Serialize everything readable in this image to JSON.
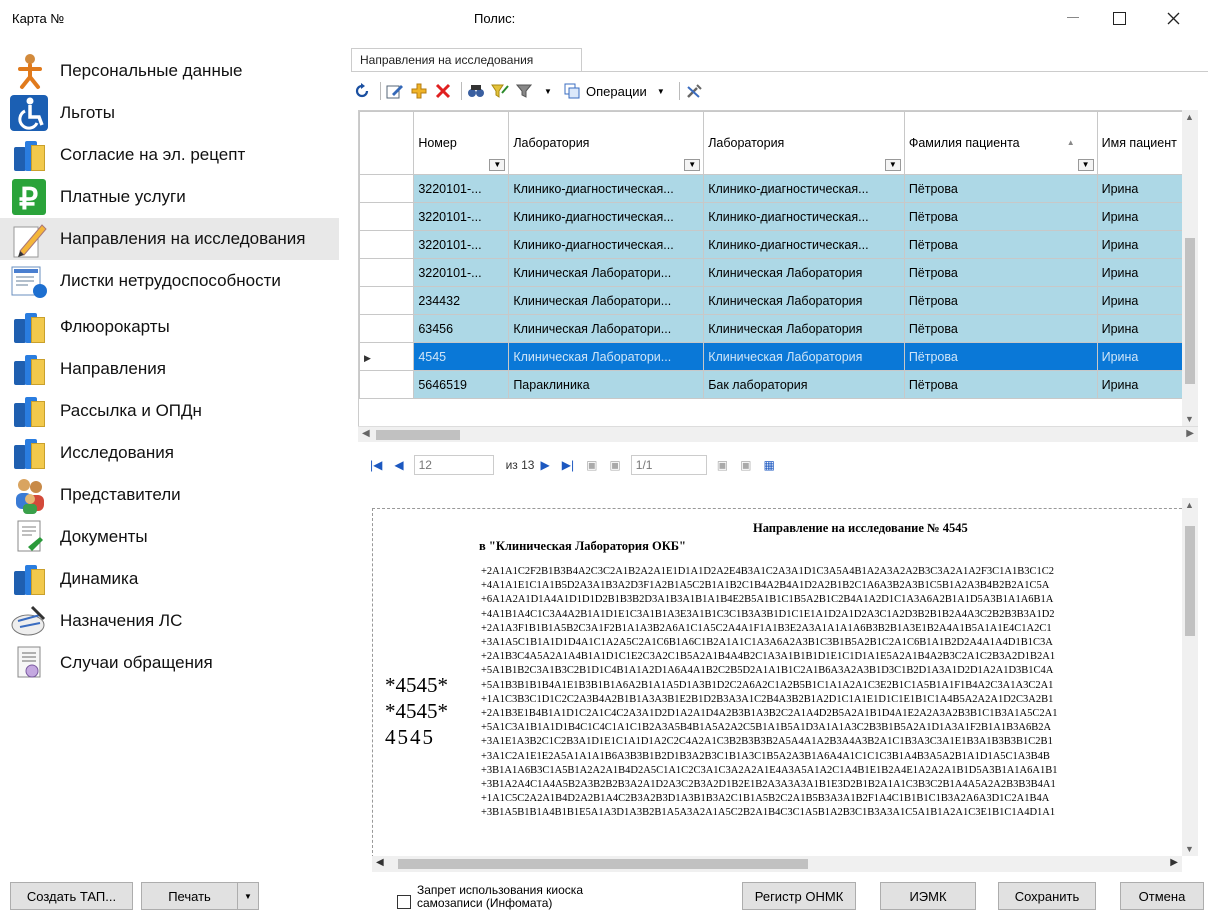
{
  "window": {
    "card_label": "Карта №",
    "policy_label": "Полис:",
    "minimize_icon": "minimize-icon",
    "maximize_icon": "maximize-icon",
    "close_icon": "close-icon"
  },
  "sidebar": {
    "items": [
      {
        "label": "Персональные данные",
        "icon": "person-icon"
      },
      {
        "label": "Льготы",
        "icon": "wheelchair-icon"
      },
      {
        "label": "Согласие на эл. рецепт",
        "icon": "books-icon"
      },
      {
        "label": "Платные услуги",
        "icon": "ruble-icon"
      },
      {
        "label": "Направления на исследования",
        "icon": "pencil-icon"
      },
      {
        "label": "Листки нетрудоспособности",
        "icon": "sick-leave-icon"
      },
      {
        "label": "Флюорокарты",
        "icon": "books-icon"
      },
      {
        "label": "Направления",
        "icon": "books-icon"
      },
      {
        "label": "Рассылка и ОПДн",
        "icon": "books-icon"
      },
      {
        "label": "Исследования",
        "icon": "books-icon"
      },
      {
        "label": "Представители",
        "icon": "people-icon"
      },
      {
        "label": "Документы",
        "icon": "document-icon"
      },
      {
        "label": "Динамика",
        "icon": "books-icon"
      },
      {
        "label": "Назначения ЛС",
        "icon": "prescription-icon"
      },
      {
        "label": "Случаи обращения",
        "icon": "case-icon"
      }
    ]
  },
  "tab": {
    "label": "Направления на исследования"
  },
  "toolbar": {
    "operations_label": "Операции"
  },
  "grid": {
    "columns": [
      "Номер",
      "Лаборатория",
      "Лаборатория",
      "Фамилия пациента",
      "Имя пациент"
    ],
    "rows": [
      [
        "3220101-...",
        "Клинико-диагностическая...",
        "Клинико-диагностическая...",
        "Пётрова",
        "Ирина"
      ],
      [
        "3220101-...",
        "Клинико-диагностическая...",
        "Клинико-диагностическая...",
        "Пётрова",
        "Ирина"
      ],
      [
        "3220101-...",
        "Клинико-диагностическая...",
        "Клинико-диагностическая...",
        "Пётрова",
        "Ирина"
      ],
      [
        "3220101-...",
        "Клиническая Лаборатори...",
        "Клиническая Лаборатория",
        "Пётрова",
        "Ирина"
      ],
      [
        "234432",
        "Клиническая Лаборатори...",
        "Клиническая Лаборатория",
        "Пётрова",
        "Ирина"
      ],
      [
        "63456",
        "Клиническая Лаборатори...",
        "Клиническая Лаборатория",
        "Пётрова",
        "Ирина"
      ],
      [
        "4545",
        "Клиническая Лаборатори...",
        "Клиническая Лаборатория",
        "Пётрова",
        "Ирина"
      ],
      [
        "5646519",
        "Параклиника",
        "Бак лаборатория",
        "Пётрова",
        "Ирина"
      ]
    ],
    "selected_row": 6
  },
  "navigator": {
    "page": "12",
    "total": "из 13",
    "zoom": "1/1"
  },
  "document": {
    "title": "Направление на исследование № 4545",
    "lab": "в \"Клиническая Лаборатория ОКБ\"",
    "barcode_1": "*4545*",
    "barcode_2": "*4545*",
    "barcode_3": "4545",
    "code_lines": [
      "+2A1A1C2F2B1B3B4A2C3C2A1B2A2A1E1D1A1D2A2E4B3A1C2A3A1D1C3A5A4B1A2A3A2A2B3C3A2A1A2F3C1A1B3C1C2",
      "+4A1A1E1C1A1B5D2A3A1B3A2D3F1A2B1A5C2B1A1B2C1B4A2B4A1D2A2B1B2C1A6A3B2A3B1C5B1A2A3B4B2B2A1C5A",
      "+6A1A2A1D1A4A1D1D1D2B1B3B2D3A1B3A1B1A1B4E2B5A1B1C1B5A2B1C2B4A1A2D1C1A3A6A2B1A1D5A3B1A1A6B1A",
      "+4A1B1A4C1C3A4A2B1A1D1E1C3A1B1A3E3A1B1C3C1B3A3B1D1C1E1A1D2A1D2A3C1A2D3B2B1B2A4A3C2B2B3B3A1D2",
      "+2A1A3F1B1B1A5B2C3A1F2B1A1A3B2A6A1C1A5C2A4A1F1A1B3E2A3A1A1A1A6B3B2B1A3E1B2A4A1B5A1A1E4C1A2C1",
      "+3A1A5C1B1A1D1D4A1C1A2A5C2A1C6B1A6C1B2A1A1C1A3A6A2A3B1C3B1B5A2B1C2A1C6B1A1B2D2A4A1A4D1B1C3A",
      "+2A1B3C4A5A2A1A4B1A1D1C1E2C3A2C1B5A2A1B4A4B2C1A3A1B1B1D1E1C1D1A1E5A2A1B4A2B3C2A1C2B3A2D1B2A1",
      "+5A1B1B2C3A1B3C2B1D1C4B1A1A2D1A6A4A1B2C2B5D2A1A1B1C2A1B6A3A2A3B1D3C1B2D1A3A1D2D1A2A1D3B1C4A",
      "+5A1B3B1B1B4A1E1B3B1B1A6A2B1A1A5D1A3B1D2C2A6A2C1A2B5B1C1A1A2A1C3E2B1C1A5B1A1F1B4A2C3A1A3C2A1",
      "+1A1C3B3C1D1C2C2A3B4A2B1B1A3A3B1E2B1D2B3A3A1C2B4A3B2B1A2D1C1A1E1D1C1E1B1C1A4B5A2A2A1D2C3A2B1",
      "+2A1B3E1B4B1A1D1C2A1C4C2A3A1D2D1A2A1D4A2B3B1A3B2C2A1A4D2B5A2A1B1D4A1E2A2A3A2B3B1C1B3A1A5C2A1",
      "+5A1C3A1B1A1D1B4C1C4C1A1C1B2A3A5B4B1A5A2A2C5B1A1B5A1D3A1A1A3C2B3B1B5A2A1D1A3A1F2B1A1B3A6B2A",
      "+3A1E1A3B2C1C2B3A1D1E1C1A1D1A2C2C4A2A1C3B2B3B3B2A5A4A1A2B3A4A3B2A1C1B3A3C3A1E1B3A1B3B3B1C2B1",
      "+3A1C2A1E1E2A5A1A1A1B6A3B3B1B2D1B3A2B3C1B1A3C1B5A2A3B1A6A4A1C1C1C3B1A4B3A5A2B1A1D1A5C1A3B4B",
      "+3B1A1A6B3C1A5B1A2A2A1B4D2A5C1A1C2C3A1C3A2A2A1E4A3A5A1A2C1A4B1E1B2A4E1A2A2A1B1D5A3B1A1A6A1B1",
      "+3B1A2A4C1A4A5B2A3B2B2B3A2A1D2A3C2B3A2D1B2E1B2A3A3A3A1B1E3D2B1B2A1A1C3B3C2B1A4A5A2A2B3B3B4A1",
      "+1A1C5C2A2A1B4D2A2B1A4C2B3A2B3D1A3B1B3A2C1B1A5B2C2A1B5B3A3A1B2F1A4C1B1B1C1B3A2A6A3D1C2A1B4A",
      "+3B1A5B1B1A4B1B1E5A1A3D1A3B2B1A5A3A2A1A5C2B2A1B4C3C1A5B1A2B3C1B3A3A1C5A1B1A2A1C3E1B1C1A4D1A1"
    ]
  },
  "footer": {
    "create_tap": "Создать ТАП...",
    "print": "Печать",
    "kiosk_label": "Запрет  использования киоска самозаписи (Инфомата)",
    "onmk": "Регистр ОНМК",
    "iemk": "ИЭМК",
    "save": "Сохранить",
    "cancel": "Отмена"
  }
}
